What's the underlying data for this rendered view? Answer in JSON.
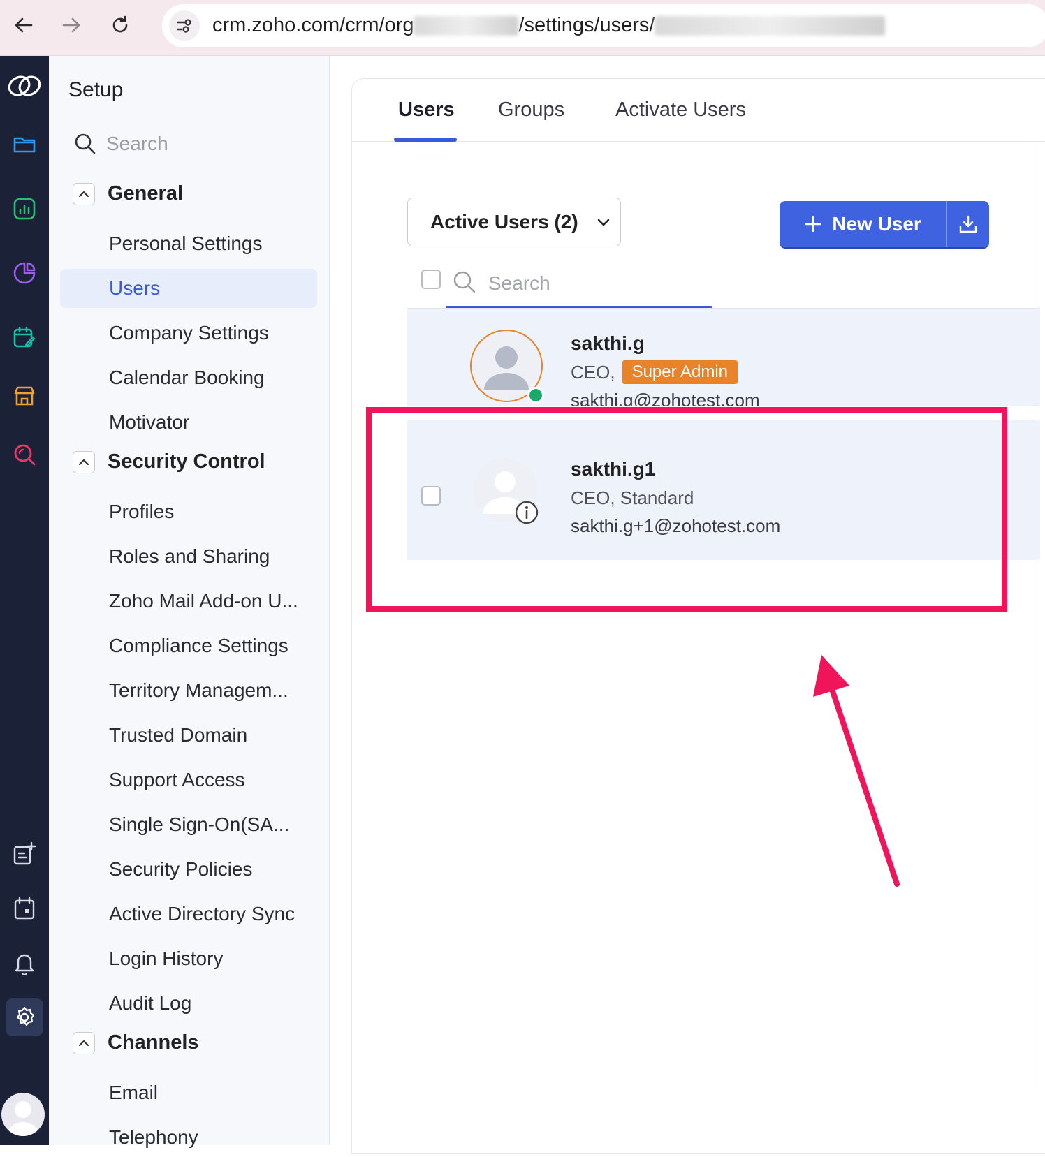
{
  "browser": {
    "url_prefix": "crm.zoho.com/crm/org",
    "url_middle": "/settings/users/"
  },
  "sidebar": {
    "title": "Setup",
    "search_placeholder": "Search",
    "sections": [
      {
        "title": "General",
        "items": [
          "Personal Settings",
          "Users",
          "Company Settings",
          "Calendar Booking",
          "Motivator"
        ]
      },
      {
        "title": "Security Control",
        "items": [
          "Profiles",
          "Roles and Sharing",
          "Zoho Mail Add-on U...",
          "Compliance Settings",
          "Territory Managem...",
          "Trusted Domain",
          "Support Access",
          "Single Sign-On(SA...",
          "Security Policies",
          "Active Directory Sync",
          "Login History",
          "Audit Log"
        ]
      },
      {
        "title": "Channels",
        "items": [
          "Email",
          "Telephony"
        ]
      }
    ],
    "active_item": "Users"
  },
  "tabs": [
    "Users",
    "Groups",
    "Activate Users"
  ],
  "active_tab": "Users",
  "toolbar": {
    "filter_label": "Active Users (2)",
    "new_user_label": "New User",
    "list_search_placeholder": "Search"
  },
  "users": [
    {
      "name": "sakthi.g",
      "role": "CEO,",
      "profile_badge": "Super Admin",
      "email": "sakthi.g@zohotest.com",
      "online": true
    },
    {
      "name": "sakthi.g1",
      "role": "CEO, Standard",
      "email": "sakthi.g+1@zohotest.com",
      "online": false
    }
  ],
  "colors": {
    "accent": "#3f63e0",
    "rail_bg": "#1b2238",
    "badge": "#e8832a",
    "annotation": "#f0145a",
    "online": "#1aa96b"
  }
}
